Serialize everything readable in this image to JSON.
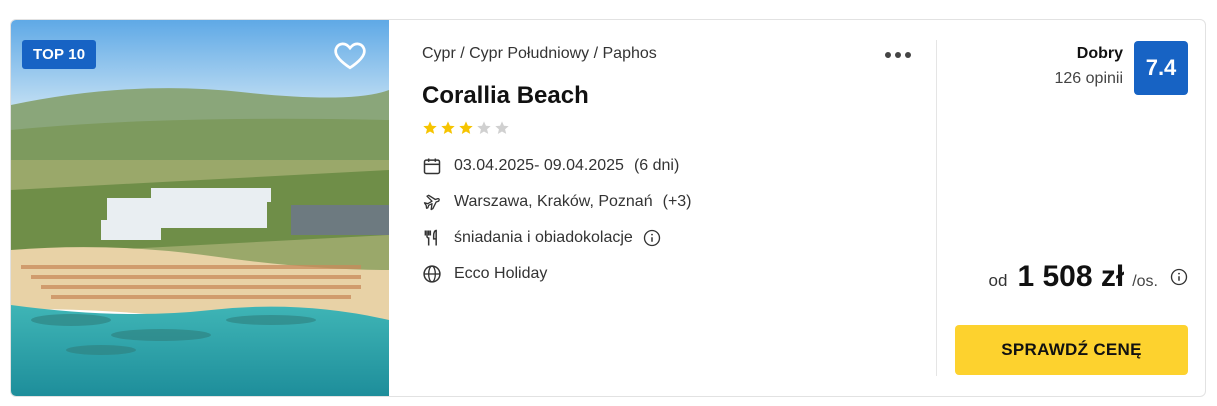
{
  "photo": {
    "badge": "TOP 10",
    "favorite_icon": "heart-outline-icon"
  },
  "hotel": {
    "breadcrumb": "Cypr / Cypr Południowy / Paphos",
    "name": "Corallia Beach",
    "stars_filled": 3,
    "stars_total": 5
  },
  "details": {
    "dates": "03.04.2025- 09.04.2025",
    "duration": "(6 dni)",
    "departures": "Warszawa, Kraków, Poznań",
    "departures_extra": "(+3)",
    "board": "śniadania i obiadokolacje",
    "operator": "Ecco Holiday"
  },
  "rating": {
    "label": "Dobry",
    "count": "126 opinii",
    "score": "7.4"
  },
  "price": {
    "prefix": "od",
    "amount": "1 508 zł",
    "unit": "/os."
  },
  "cta": {
    "label": "SPRAWDŹ CENĘ"
  },
  "colors": {
    "accent_blue": "#1763c4",
    "cta_yellow": "#fdd22e",
    "star_gold": "#f6c400",
    "star_grey": "#d0d0d0"
  }
}
